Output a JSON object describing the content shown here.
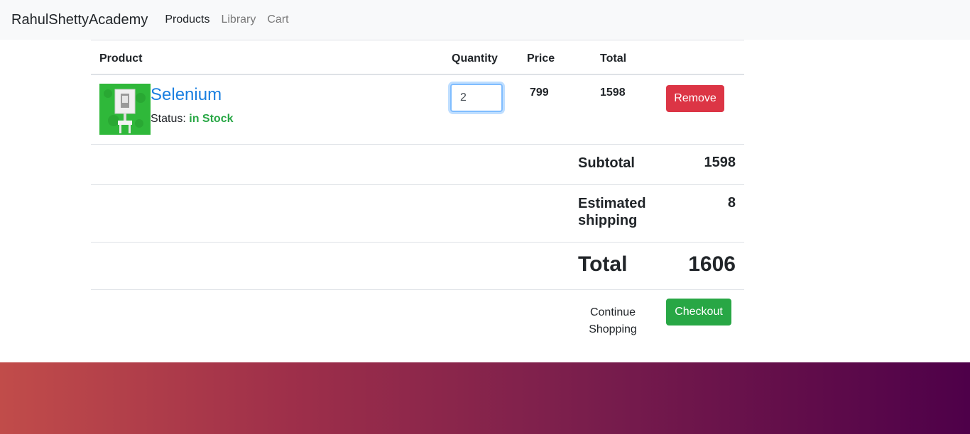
{
  "navbar": {
    "brand": "RahulShettyAcademy",
    "links": [
      {
        "label": "Products"
      },
      {
        "label": "Library"
      },
      {
        "label": "Cart"
      }
    ]
  },
  "table": {
    "headers": {
      "product": "Product",
      "quantity": "Quantity",
      "price": "Price",
      "total": "Total"
    },
    "items": [
      {
        "name": "Selenium",
        "status_prefix": "Status:",
        "status_value": "in Stock",
        "quantity": "2",
        "price": "799",
        "total": "1598",
        "remove_label": "Remove"
      }
    ]
  },
  "summary": {
    "subtotal_label": "Subtotal",
    "subtotal_value": "1598",
    "shipping_label": "Estimated shipping",
    "shipping_value": "8",
    "total_label": "Total",
    "total_value": "1606"
  },
  "actions": {
    "continue_label": "Continue Shopping",
    "checkout_label": "Checkout"
  },
  "colors": {
    "link_blue": "#1a7fe0",
    "in_stock_green": "#28a745",
    "remove_red": "#dc3545",
    "checkout_green": "#28a745"
  }
}
